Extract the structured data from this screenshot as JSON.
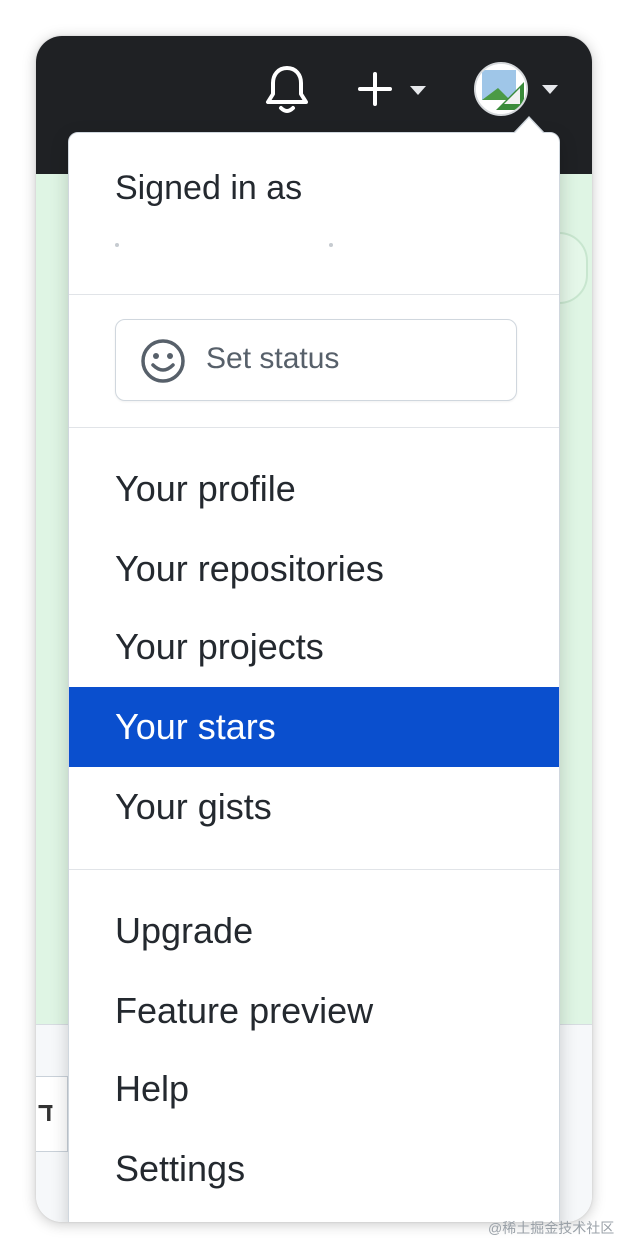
{
  "header": {
    "bell_icon": "bell-icon",
    "create_icon": "plus-icon",
    "create_caret_icon": "caret-down-icon",
    "avatar_icon": "avatar-image",
    "avatar_caret_icon": "caret-down-icon",
    "background_color": "#1f2124"
  },
  "page": {
    "side_text": "ד"
  },
  "dropdown": {
    "signed_in_label": "Signed in as",
    "set_status_label": "Set status",
    "status_icon": "smiley-icon",
    "menu_group_1": [
      {
        "label": "Your profile",
        "active": false
      },
      {
        "label": "Your repositories",
        "active": false
      },
      {
        "label": "Your projects",
        "active": false
      },
      {
        "label": "Your stars",
        "active": true
      },
      {
        "label": "Your gists",
        "active": false
      }
    ],
    "menu_group_2": [
      {
        "label": "Upgrade",
        "active": false
      },
      {
        "label": "Feature preview",
        "active": false
      },
      {
        "label": "Help",
        "active": false
      },
      {
        "label": "Settings",
        "active": false
      }
    ],
    "active_color": "#0a4fce"
  },
  "watermark": "@稀土掘金技术社区"
}
